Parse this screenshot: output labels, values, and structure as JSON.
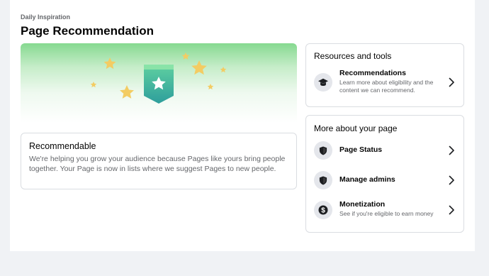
{
  "header": {
    "eyebrow": "Daily Inspiration",
    "title": "Page Recommendation"
  },
  "recommendable": {
    "title": "Recommendable",
    "description": "We're helping you grow your audience because Pages like yours bring people together. Your Page is now in lists where we suggest Pages to new people."
  },
  "resources": {
    "title": "Resources and tools",
    "items": [
      {
        "label": "Recommendations",
        "sub": "Learn more about eligibility and the content we can recommend.",
        "icon": "graduation-cap-icon"
      }
    ]
  },
  "more": {
    "title": "More about your page",
    "items": [
      {
        "label": "Page Status",
        "icon": "shield-icon"
      },
      {
        "label": "Manage admins",
        "icon": "shield-icon"
      },
      {
        "label": "Monetization",
        "sub": "See if you're eligible to earn money",
        "icon": "dollar-icon"
      }
    ]
  },
  "colors": {
    "badge_top": "#43c07a",
    "badge_bottom": "#2b9e9a",
    "star": "#f3cc63",
    "hero_green": "#86d990"
  }
}
